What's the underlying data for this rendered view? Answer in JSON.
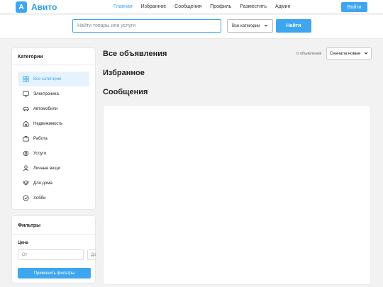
{
  "header": {
    "logo_letter": "А",
    "logo_text": "Авито",
    "nav": [
      "Главная",
      "Избранное",
      "Сообщения",
      "Профиль",
      "Разместить",
      "Админ"
    ],
    "active_nav": "Главная",
    "login_label": "Войти"
  },
  "search": {
    "placeholder": "Найти товары или услуги",
    "category_value": "Все категории",
    "button_label": "Найти"
  },
  "sidebar": {
    "title": "Категории",
    "items": [
      {
        "label": "Все категории",
        "icon": "grid-icon",
        "active": true
      },
      {
        "label": "Электроника",
        "icon": "monitor-icon"
      },
      {
        "label": "Автомобили",
        "icon": "car-icon"
      },
      {
        "label": "Недвижимость",
        "icon": "house-icon"
      },
      {
        "label": "Работа",
        "icon": "briefcase-icon"
      },
      {
        "label": "Услуги",
        "icon": "gear-icon"
      },
      {
        "label": "Личные вещи",
        "icon": "person-icon"
      },
      {
        "label": "Для дома",
        "icon": "layers-icon"
      },
      {
        "label": "Хобби",
        "icon": "check-circle-icon"
      }
    ]
  },
  "filters": {
    "title": "Фильтры",
    "price_label": "Цена",
    "from_placeholder": "От",
    "to_placeholder": "До",
    "apply_label": "Применить фильтры"
  },
  "main": {
    "all_title": "Все объявления",
    "count_text": "0 объявлений",
    "sort_value": "Сначала новые",
    "favorites_title": "Избранное",
    "messages_title": "Сообщения"
  },
  "colors": {
    "accent": "#3ea6f0",
    "active_bg": "#e6f3fd"
  }
}
